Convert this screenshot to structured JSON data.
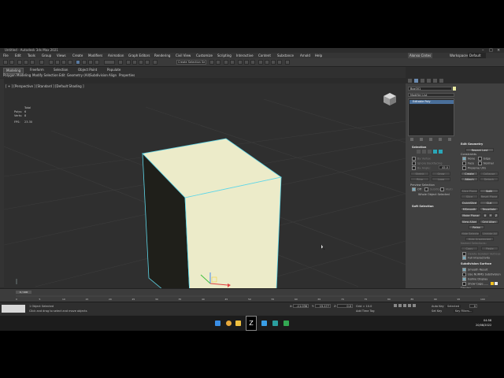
{
  "window": {
    "title": "Untitled - Autodesk 3ds Max 2021"
  },
  "menu": [
    "File",
    "Edit",
    "Tools",
    "Group",
    "Views",
    "Create",
    "Modifiers",
    "Animation",
    "Graph Editors",
    "Rendering",
    "Civil View",
    "Customize",
    "Scripting",
    "Interactive",
    "Content",
    "Substance",
    "Arnold",
    "Help"
  ],
  "account": {
    "user": "Alonso Cintes",
    "workspaces_label": "Workspaces:",
    "workspace_value": "Default"
  },
  "toolbar": {
    "selection_set": "Create Selection Se"
  },
  "ribbon": {
    "tabs": [
      "Modeling",
      "Freeform",
      "Selection",
      "Object Paint",
      "Populate"
    ],
    "subtabs": [
      "Polygon Modeling",
      "Modify Selection",
      "Edit",
      "Geometry (All)",
      "Subdivision",
      "Align",
      "Properties"
    ]
  },
  "viewport": {
    "label": "[ + ] [Perspective ] [Standard ] [Default Shading ]",
    "stats": {
      "header": "Total",
      "polys_label": "Polys:",
      "polys_value": "6",
      "verts_label": "Verts:",
      "verts_value": "8",
      "fps_label": "FPS:",
      "fps_value": "23.30"
    }
  },
  "panel": {
    "object_name": "Box001",
    "modifier_list": "Modifier List",
    "stack_item": "Editable Poly",
    "selection": {
      "title": "Selection",
      "by_vertex": "By Vertex",
      "ignore_backfacing": "Ignore Backfacing",
      "by_angle": "By Angle:",
      "angle_value": "45.0",
      "shrink": "Shrink",
      "grow": "Grow",
      "ring": "Ring",
      "loop": "Loop",
      "preview_selection": "Preview Selection",
      "off": "Off",
      "subobj": "SubObj",
      "multi": "Multi",
      "whole_object": "Whole Object Selected"
    },
    "soft_selection": "Soft Selection",
    "edit_geometry": {
      "title": "Edit Geometry",
      "repeat_last": "Repeat Last",
      "constraints": "Constraints",
      "none": "None",
      "edge": "Edge",
      "face": "Face",
      "normal": "Normal",
      "preserve_uvs": "Preserve UVs",
      "create": "Create",
      "collapse": "Collapse",
      "attach": "Attach",
      "detach": "Detach",
      "slice_plane": "Slice Plane",
      "split": "Split",
      "slice": "Slice",
      "reset_plane": "Reset Plane",
      "quickslice": "QuickSlice",
      "cut": "Cut",
      "msmooth": "MSmooth",
      "tessellate": "Tessellate",
      "make_planar": "Make Planar",
      "x": "X",
      "y": "Y",
      "z": "Z",
      "view_align": "View Align",
      "grid_align": "Grid Align",
      "relax": "Relax",
      "hide_selected": "Hide Selected",
      "unhide_all": "Unhide All",
      "hide_unselected": "Hide Unselected",
      "named_selections": "Named Selections:",
      "copy": "Copy",
      "paste": "Paste",
      "delete_isolated": "Delete Isolated Vertices",
      "full_interactivity": "Full Interactivity"
    },
    "subdivision_surface": {
      "title": "Subdivision Surface",
      "smooth_result": "Smooth Result",
      "use_nurms": "Use NURMS Subdivision",
      "isoline_display": "Isoline Display",
      "show_cage": "Show Cage......",
      "display": "Display",
      "iterations_label": "Iterations:",
      "iterations_value": "1",
      "smoothness_label": "Smoothness:",
      "smoothness_value": "1.0",
      "render": "Render",
      "r_iterations": "Iterations:",
      "r_iterations_value": "0",
      "r_smoothness": "Smoothness:",
      "r_smoothness_value": "1.0",
      "separate_by": "Separate By",
      "smoothing_groups": "Smoothing Groups",
      "materials": "Materials"
    }
  },
  "timeline": {
    "slider": "0 / 100",
    "ticks": [
      "0",
      "5",
      "10",
      "15",
      "20",
      "25",
      "30",
      "35",
      "40",
      "45",
      "50",
      "55",
      "60",
      "65",
      "70",
      "75",
      "80",
      "85",
      "90",
      "95",
      "100"
    ]
  },
  "status": {
    "selected": "1 Object Selected",
    "prompt": "Click and drag to select and move objects",
    "x_label": "X:",
    "x_value": "-11.036",
    "y_label": "Y:",
    "y_value": "15.177",
    "z_label": "Z:",
    "z_value": "0.0",
    "grid": "Grid = 10.0",
    "add_time_tag": "Add Time Tag",
    "auto_key": "Auto Key",
    "set_key": "Set Key",
    "selected_label": "Selected",
    "key_filters": "Key Filters...",
    "frame": "0"
  },
  "taskbar": {
    "time": "04:58",
    "date": "20/08/2022"
  },
  "colors": {
    "box_face": "#ecebc9",
    "box_side": "#1f1f1a",
    "select_outline": "#5ed6e8",
    "accent_blue": "#4a6f9a"
  }
}
